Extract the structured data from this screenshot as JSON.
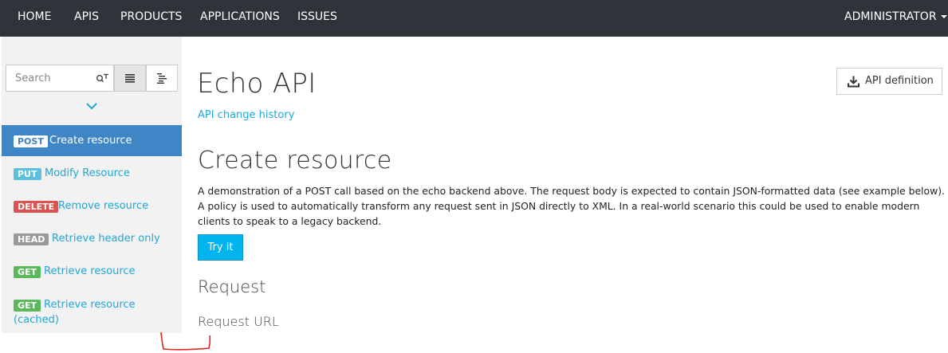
{
  "nav": {
    "items": [
      "HOME",
      "APIS",
      "PRODUCTS",
      "APPLICATIONS",
      "ISSUES"
    ],
    "user": "ADMINISTRATOR"
  },
  "sidebar": {
    "search_placeholder": "Search",
    "operations": [
      {
        "method": "POST",
        "label": "Create resource",
        "color": "#ffffff",
        "text_color": "#3f86c7",
        "active": true
      },
      {
        "method": "PUT",
        "label": "Modify Resource",
        "color": "#5bc0de"
      },
      {
        "method": "DELETE",
        "label": "Remove resource",
        "color": "#d9534f"
      },
      {
        "method": "HEAD",
        "label": "Retrieve header only",
        "color": "#999999"
      },
      {
        "method": "GET",
        "label": "Retrieve resource",
        "color": "#5cb85c"
      },
      {
        "method": "GET",
        "label_line1": "Retrieve resource",
        "label_line2": "(cached)",
        "color": "#5cb85c"
      }
    ]
  },
  "main": {
    "api_title": "Echo API",
    "change_history_link": "API change history",
    "api_definition_label": "API definition",
    "operation_title": "Create resource",
    "description": "A demonstration of a POST call based on the echo backend above. The request body is expected to contain JSON-formatted data (see example below). A policy is used to automatically transform any request sent in JSON directly to XML. In a real-world scenario this could be used to enable modern clients to speak to a legacy backend.",
    "try_it_label": "Try it",
    "request_heading": "Request",
    "request_url_heading": "Request URL"
  },
  "colors": {
    "nav_bg": "#2f343b",
    "accent": "#1fa8d7",
    "active_bg": "#3f86c7",
    "try_button": "#00b4f0",
    "annotation": "#e0281e"
  }
}
